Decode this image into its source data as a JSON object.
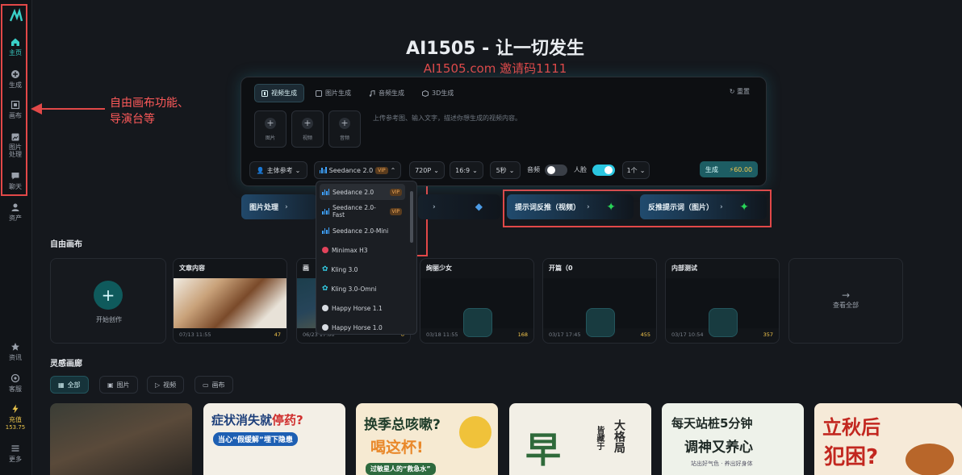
{
  "sidebar": {
    "items": [
      {
        "label": "主页",
        "icon": "home-icon"
      },
      {
        "label": "生成",
        "icon": "plus-circle-icon"
      },
      {
        "label": "画布",
        "icon": "canvas-icon"
      },
      {
        "label": "图片处理",
        "line1": "图片",
        "line2": "处理",
        "icon": "image-edit-icon"
      },
      {
        "label": "聊天",
        "icon": "chat-icon"
      },
      {
        "label": "资产",
        "icon": "user-icon"
      },
      {
        "label": "资讯",
        "icon": "star-icon"
      },
      {
        "label": "客服",
        "icon": "support-icon"
      },
      {
        "label": "充值",
        "sub": "153.75",
        "icon": "bolt-icon"
      },
      {
        "label": "更多",
        "icon": "menu-icon"
      }
    ]
  },
  "annotation": {
    "line1": "自由画布功能、",
    "line2": "导演台等"
  },
  "hero": {
    "title": "AI1505 - 让一切发生",
    "subtitle": "AI1505.com 邀请码1111"
  },
  "composer": {
    "tabs": [
      "视频生成",
      "图片生成",
      "音频生成",
      "3D生成"
    ],
    "reset": "重置",
    "uploads": [
      "图片",
      "视频",
      "音频"
    ],
    "placeholder": "上传参考图、输入文字，描述你想生成的视频内容。",
    "subject_ref": "主体参考",
    "model": "Seedance 2.0",
    "model_badge": "VIP",
    "resolution": "720P",
    "ratio": "16:9",
    "duration": "5秒",
    "audio_label": "音频",
    "face_label": "人脸",
    "count": "1个",
    "generate": "生成",
    "cost": "60.00"
  },
  "model_dropdown": [
    {
      "name": "Seedance 2.0",
      "badge": "VIP",
      "icon": "bars-icon"
    },
    {
      "name": "Seedance 2.0-Fast",
      "badge": "VIP",
      "icon": "bars-icon"
    },
    {
      "name": "Seedance 2.0-Mini",
      "badge": "",
      "icon": "bars-icon"
    },
    {
      "name": "Minimax H3",
      "badge": "",
      "icon": "minimax-icon"
    },
    {
      "name": "Kling 3.0",
      "badge": "",
      "icon": "kling-icon"
    },
    {
      "name": "Kling 3.0-Omni",
      "badge": "",
      "icon": "kling-icon"
    },
    {
      "name": "Happy Horse 1.1",
      "badge": "",
      "icon": "horse-icon"
    },
    {
      "name": "Happy Horse 1.0",
      "badge": "",
      "icon": "horse-icon"
    }
  ],
  "actions": [
    {
      "label": "图片处理"
    },
    {
      "label": "提示词反推（视频）"
    },
    {
      "label": "反推提示词（图片）"
    }
  ],
  "free_canvas": {
    "title": "自由画布",
    "start": "开始创作",
    "cards": [
      {
        "title": "文章内容",
        "date": "07/13 11:55",
        "points": "47"
      },
      {
        "title": "画",
        "date": "06/23 17:00",
        "points": "0"
      },
      {
        "title": "绚丽少女",
        "date": "03/18 11:55",
        "points": "168"
      },
      {
        "title": "开篇（0",
        "date": "03/17 17:45",
        "points": "455"
      },
      {
        "title": "内部测试",
        "date": "03/17 10:54",
        "points": "357"
      }
    ],
    "view_all": "查看全部"
  },
  "gallery": {
    "title": "灵感画廊",
    "filters": [
      "全部",
      "图片",
      "视频",
      "画布"
    ],
    "posters": [
      {
        "text": ""
      },
      {
        "line1": "症状消失就",
        "hl": "停药?",
        "line2": "当心“假缓解”埋下隐患"
      },
      {
        "line1": "换季总咳嗽?",
        "line2": "喝这杯!",
        "line3": "过敏星人的“救急水”"
      },
      {
        "line1": "早",
        "side": "大格局",
        "side2": "皆藏于"
      },
      {
        "line1": "每天站桩5分钟",
        "line2": "调神又养心",
        "line3": "站出好气色 · 养出好身体"
      },
      {
        "line1": "立秋后",
        "line2": "犯困?"
      }
    ]
  },
  "colors": {
    "accent": "#3ad0c8",
    "annotation": "#e24848",
    "points": "#f6c84c"
  }
}
